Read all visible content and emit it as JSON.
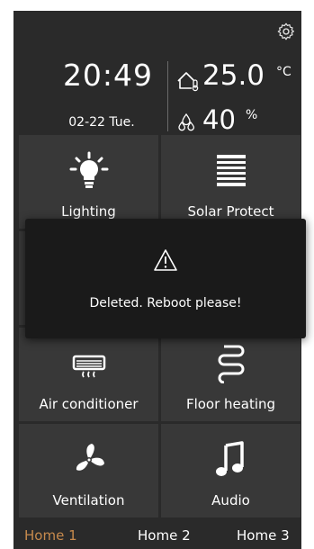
{
  "header": {
    "time": "20:49",
    "date": "02-22 Tue.",
    "temperature": "25.0",
    "temperature_unit": "°C",
    "humidity": "40",
    "humidity_unit": "%"
  },
  "tiles": [
    {
      "label": "Lighting",
      "icon": "light-bulb-icon"
    },
    {
      "label": "Solar Protect",
      "icon": "blinds-icon"
    },
    {
      "label": "",
      "icon": "hidden"
    },
    {
      "label": "",
      "icon": "hidden"
    },
    {
      "label": "Air conditioner",
      "icon": "air-conditioner-icon"
    },
    {
      "label": "Floor heating",
      "icon": "floor-heating-icon"
    },
    {
      "label": "Ventilation",
      "icon": "fan-icon"
    },
    {
      "label": "Audio",
      "icon": "music-note-icon"
    }
  ],
  "partial_unit": "°C",
  "homes": [
    "Home 1",
    "Home 2",
    "Home 3"
  ],
  "active_home": "Home 1",
  "toast": {
    "message": "Deleted. Reboot please!",
    "icon": "warning-icon"
  },
  "colors": {
    "background": "#2a2a2a",
    "tile": "#383838",
    "active_tab": "#c78a4d",
    "toast": "#1a1a1a"
  }
}
